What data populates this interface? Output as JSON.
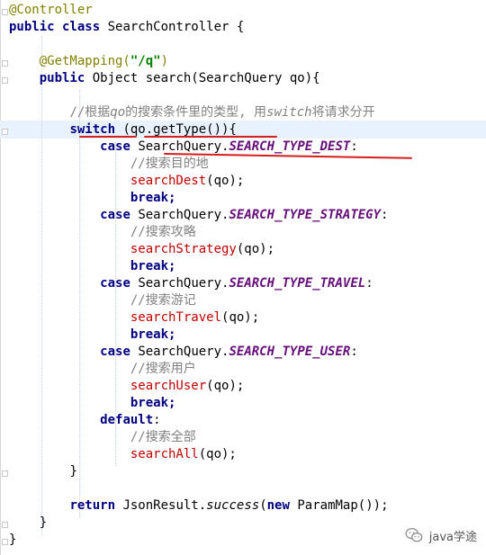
{
  "code": {
    "l01": "@Controller",
    "l02_kw": "public class",
    "l02_rest": " SearchController {",
    "l04": "@GetMapping(",
    "l04_str": "\"/q\"",
    "l04_end": ")",
    "l05_kw": "public",
    "l05_rest": " Object search(SearchQuery qo){",
    "l07_a": "//根据",
    "l07_b": "qo",
    "l07_c": "的搜索条件里的类型, 用",
    "l07_d": "switch",
    "l07_e": "将请求分开",
    "l08_kw": "switch",
    "l08_rest": " (qo.getType()){",
    "case_kw": "case",
    "sq": "SearchQuery.",
    "c1_const": "SEARCH_TYPE_DEST",
    "c1_cmt": "//搜索目的地",
    "c1_call": "searchDest",
    "c2_const": "SEARCH_TYPE_STRATEGY",
    "c2_cmt": "//搜索攻略",
    "c2_call": "searchStrategy",
    "c3_const": "SEARCH_TYPE_TRAVEL",
    "c3_cmt": "//搜索游记",
    "c3_call": "searchTravel",
    "c4_const": "SEARCH_TYPE_USER",
    "c4_cmt": "//搜索用户",
    "c4_call": "searchUser",
    "default_kw": "default",
    "d_cmt": "//搜索全部",
    "d_call": "searchAll",
    "args": "(qo);",
    "colon": ":",
    "break_kw": "break;",
    "close": "}",
    "ret_kw": "return",
    "ret_a": " JsonResult.",
    "ret_b": "success",
    "ret_c": "(",
    "ret_new": "new",
    "ret_d": " ParamMap());"
  },
  "watermark": {
    "label": "java学途",
    "icon": "wechat-icon"
  },
  "colors": {
    "keyword": "#000080",
    "annotation": "#808000",
    "string": "#008000",
    "comment": "#808080",
    "constant": "#660e7a",
    "method_call": "#c00000",
    "underline": "#d51e1e",
    "line_highlight": "#e8f2fe"
  }
}
